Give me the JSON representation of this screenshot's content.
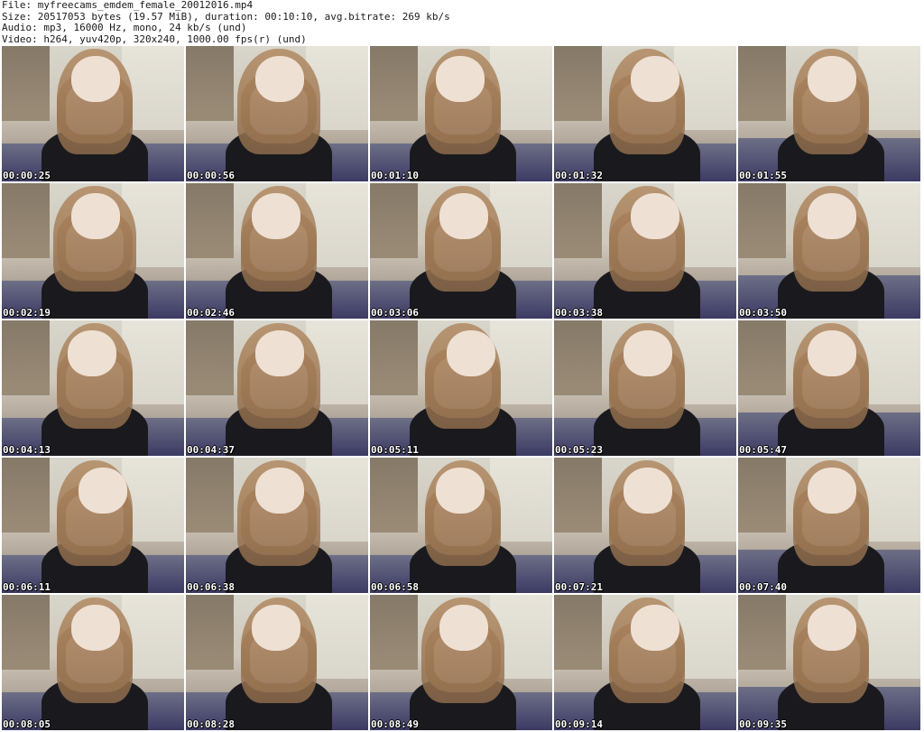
{
  "header": {
    "file": "File: myfreecams_emdem_female_20012016.mp4",
    "size": "Size: 20517053 bytes (19.57 MiB), duration: 00:10:10, avg.bitrate: 269 kb/s",
    "audio": "Audio: mp3, 16000 Hz, mono, 24 kb/s (und)",
    "video": "Video: h264, yuv420p, 320x240, 1000.00 fps(r) (und)"
  },
  "thumbnails": [
    {
      "time": "00:00:25"
    },
    {
      "time": "00:00:56"
    },
    {
      "time": "00:01:10"
    },
    {
      "time": "00:01:32"
    },
    {
      "time": "00:01:55"
    },
    {
      "time": "00:02:19"
    },
    {
      "time": "00:02:46"
    },
    {
      "time": "00:03:06"
    },
    {
      "time": "00:03:38"
    },
    {
      "time": "00:03:50"
    },
    {
      "time": "00:04:13"
    },
    {
      "time": "00:04:37"
    },
    {
      "time": "00:05:11"
    },
    {
      "time": "00:05:23"
    },
    {
      "time": "00:05:47"
    },
    {
      "time": "00:06:11"
    },
    {
      "time": "00:06:38"
    },
    {
      "time": "00:06:58"
    },
    {
      "time": "00:07:21"
    },
    {
      "time": "00:07:40"
    },
    {
      "time": "00:08:05"
    },
    {
      "time": "00:08:28"
    },
    {
      "time": "00:08:49"
    },
    {
      "time": "00:09:14"
    },
    {
      "time": "00:09:35"
    }
  ]
}
